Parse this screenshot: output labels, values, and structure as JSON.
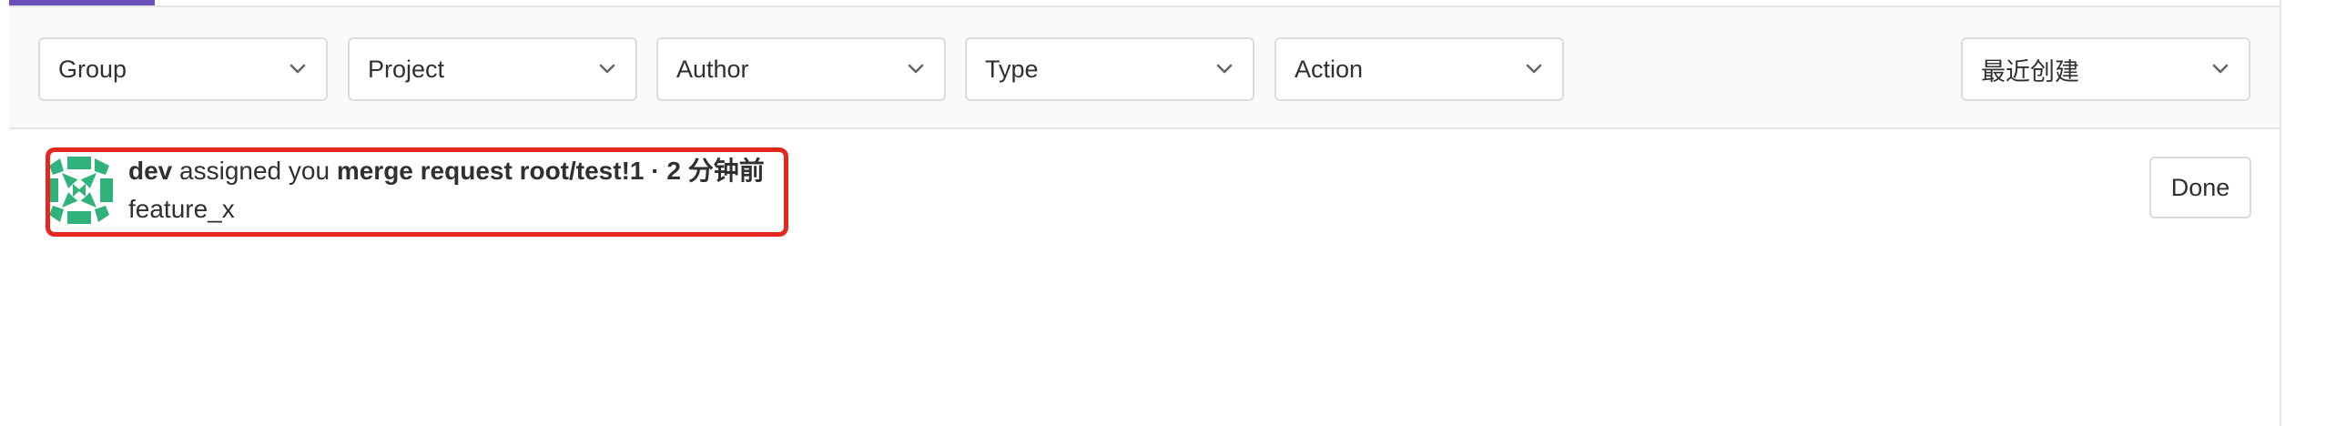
{
  "filters": {
    "group": "Group",
    "project": "Project",
    "author": "Author",
    "type": "Type",
    "action": "Action",
    "sort": "最近创建"
  },
  "todo": {
    "author": "dev",
    "action_text": "assigned you",
    "target": "merge request root/test!1",
    "separator": "·",
    "time": "2 分钟前",
    "title": "feature_x",
    "done_label": "Done"
  },
  "colors": {
    "tab_indicator": "#6b4fbb",
    "highlight": "#e5281e",
    "avatar": "#2fb37a"
  },
  "icons": {
    "dropdown": "chevron-down-icon",
    "avatar": "identicon-avatar"
  }
}
